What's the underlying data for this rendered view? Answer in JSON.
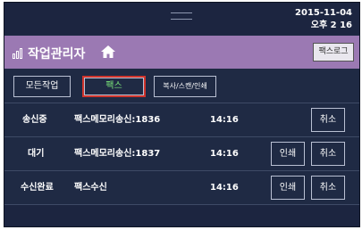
{
  "status_bar": {
    "date": "2015-11-04",
    "time": "오후 2  16"
  },
  "header": {
    "title": "작업관리자",
    "fax_log_label": "팩스로그"
  },
  "tabs": [
    {
      "label": "모든작업",
      "active": false
    },
    {
      "label": "팩스",
      "active": true
    },
    {
      "label": "복사/스캔/인쇄",
      "active": false
    }
  ],
  "jobs": [
    {
      "status": "송신중",
      "name": "팩스메모리송신:1836",
      "time": "14:16",
      "print_label": "",
      "cancel_label": "취소"
    },
    {
      "status": "대기",
      "name": "팩스메모리송신:1837",
      "time": "14:16",
      "print_label": "인쇄",
      "cancel_label": "취소"
    },
    {
      "status": "수신완료",
      "name": "팩스수신",
      "time": "14:16",
      "print_label": "인쇄",
      "cancel_label": "취소"
    }
  ],
  "colors": {
    "background": "#1f2a44",
    "title_bar": "#9b79b3",
    "active_tab_border": "#d0342c",
    "active_tab_text": "#7be57a"
  }
}
